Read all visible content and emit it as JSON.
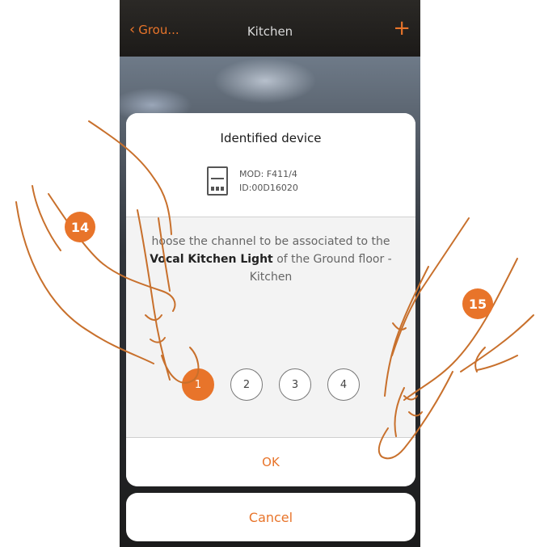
{
  "header": {
    "back_label": "Grou...",
    "title": "Kitchen",
    "add_glyph": "+"
  },
  "dialog": {
    "title": "Identified device",
    "device": {
      "model": "MOD: F411/4",
      "id": "ID:00D16020"
    },
    "message": {
      "prefix": "hoose the channel to be associated to the",
      "highlight": "Vocal Kitchen Light",
      "suffix": "of the Ground floor - Kitchen"
    },
    "channels": [
      "1",
      "2",
      "3",
      "4"
    ],
    "selected_channel": "1",
    "ok_label": "OK"
  },
  "cancel_label": "Cancel",
  "steps": {
    "left": "14",
    "right": "15"
  },
  "colors": {
    "accent": "#e8742a"
  }
}
